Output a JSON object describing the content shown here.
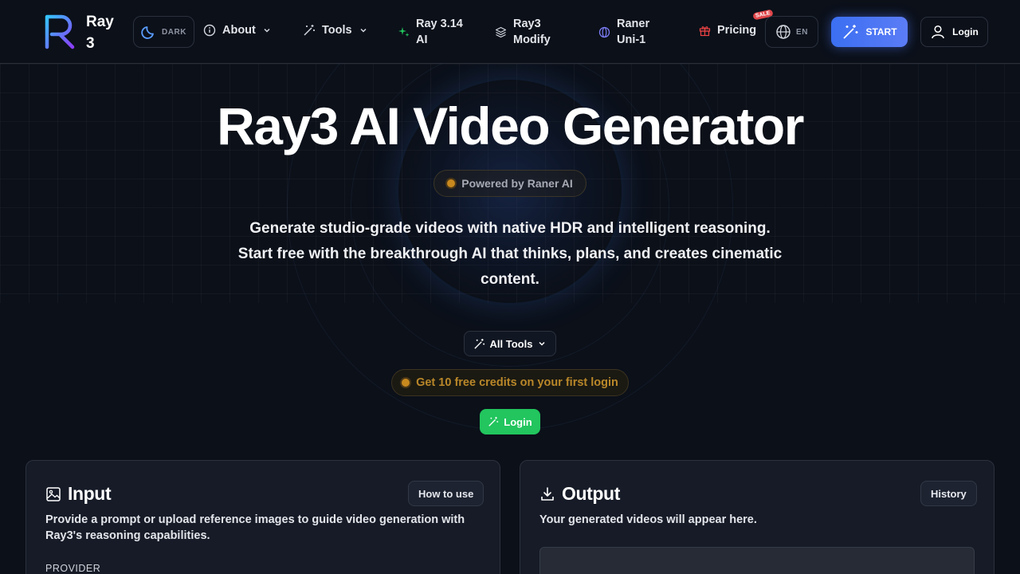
{
  "brand": {
    "name": "Ray 3"
  },
  "header": {
    "theme_toggle": "DARK",
    "nav": [
      {
        "label": "About",
        "has_dropdown": true,
        "icon": "info-icon"
      },
      {
        "label": "Tools",
        "has_dropdown": true,
        "icon": "magic-wand-icon"
      },
      {
        "label": "Ray 3.14 AI",
        "icon": "sparkle-icon"
      },
      {
        "label": "Ray3 Modify",
        "icon": "layers-icon"
      },
      {
        "label": "Raner Uni-1",
        "icon": "orbit-icon"
      },
      {
        "label": "Pricing",
        "icon": "gift-icon",
        "badge": "SALE"
      }
    ],
    "language": "EN",
    "start_label": "START",
    "login_label": "Login"
  },
  "hero": {
    "title": "Ray3 AI Video Generator",
    "powered_by": "Powered by Raner AI",
    "subtitle": "Generate studio-grade videos with native HDR and intelligent reasoning. Start free with the breakthrough AI that thinks, plans, and creates cinematic content.",
    "all_tools_label": "All Tools",
    "credits_text": "Get 10 free credits on your first login",
    "login_label": "Login"
  },
  "input_panel": {
    "title": "Input",
    "how_to_use": "How to use",
    "description": "Provide a prompt or upload reference images to guide video generation with Ray3's reasoning capabilities.",
    "provider_label": "PROVIDER"
  },
  "output_panel": {
    "title": "Output",
    "history": "History",
    "description": "Your generated videos will appear here."
  },
  "colors": {
    "background": "#0b1019",
    "accent_blue": "#3b6ff2",
    "green": "#22c55e",
    "amber": "#c8891e",
    "sale_red": "#e0464a"
  }
}
